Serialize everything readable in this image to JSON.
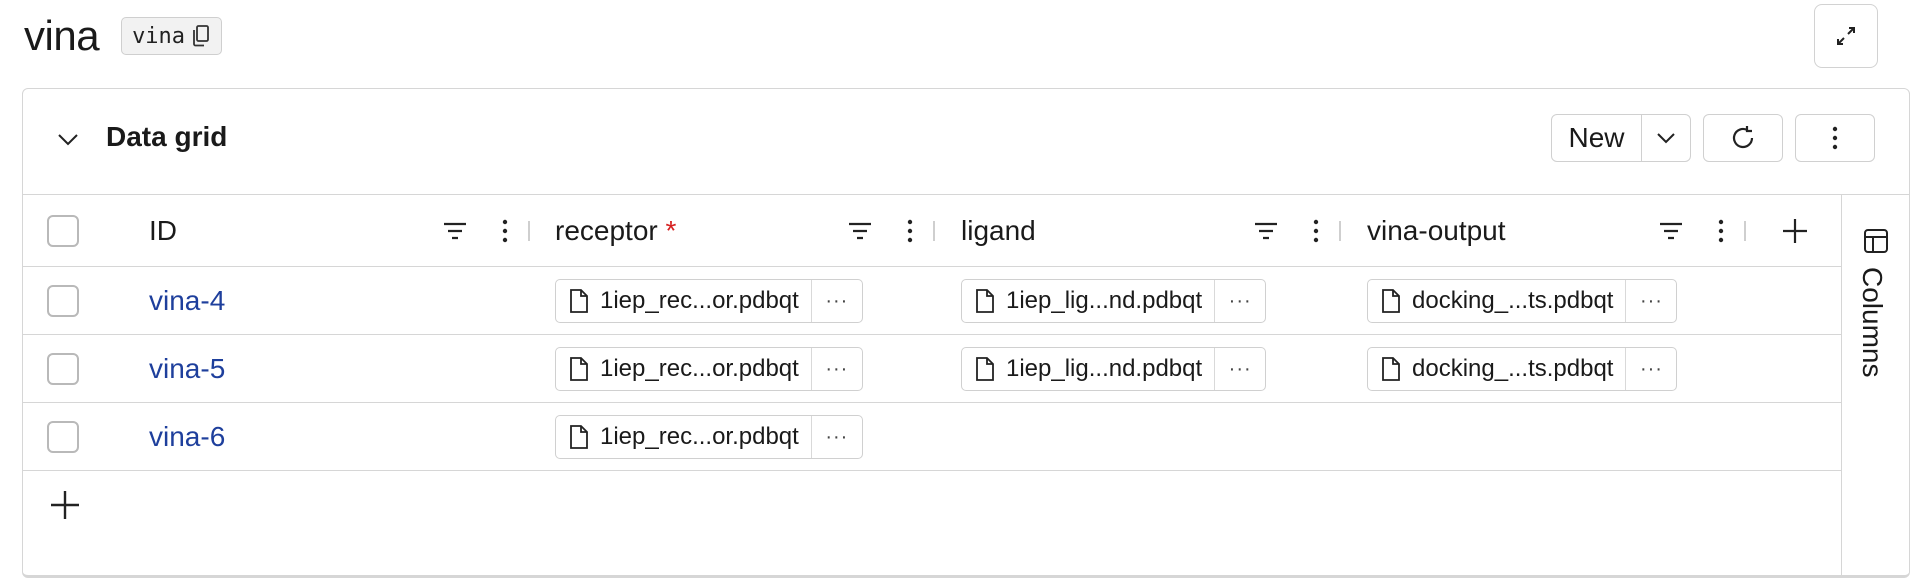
{
  "page": {
    "title": "vina",
    "tag_label": "vina"
  },
  "panel": {
    "title": "Data grid",
    "new_label": "New"
  },
  "grid": {
    "columns": [
      {
        "label": "ID",
        "required": false
      },
      {
        "label": "receptor",
        "required": true
      },
      {
        "label": "ligand",
        "required": false
      },
      {
        "label": "vina-output",
        "required": false
      }
    ],
    "required_marker": "*",
    "rows": [
      {
        "id": "vina-4",
        "receptor": "1iep_rec...or.pdbqt",
        "ligand": "1iep_lig...nd.pdbqt",
        "vina_output": "docking_...ts.pdbqt"
      },
      {
        "id": "vina-5",
        "receptor": "1iep_rec...or.pdbqt",
        "ligand": "1iep_lig...nd.pdbqt",
        "vina_output": "docking_...ts.pdbqt"
      },
      {
        "id": "vina-6",
        "receptor": "1iep_rec...or.pdbqt",
        "ligand": "",
        "vina_output": ""
      }
    ],
    "chip_more_label": "···"
  },
  "side_panel": {
    "label": "Columns"
  },
  "icons": [
    "copy-icon",
    "expand-icon",
    "chevron-down-icon",
    "refresh-icon",
    "more-vertical-icon",
    "filter-icon",
    "plus-icon",
    "file-icon",
    "table-icon"
  ]
}
